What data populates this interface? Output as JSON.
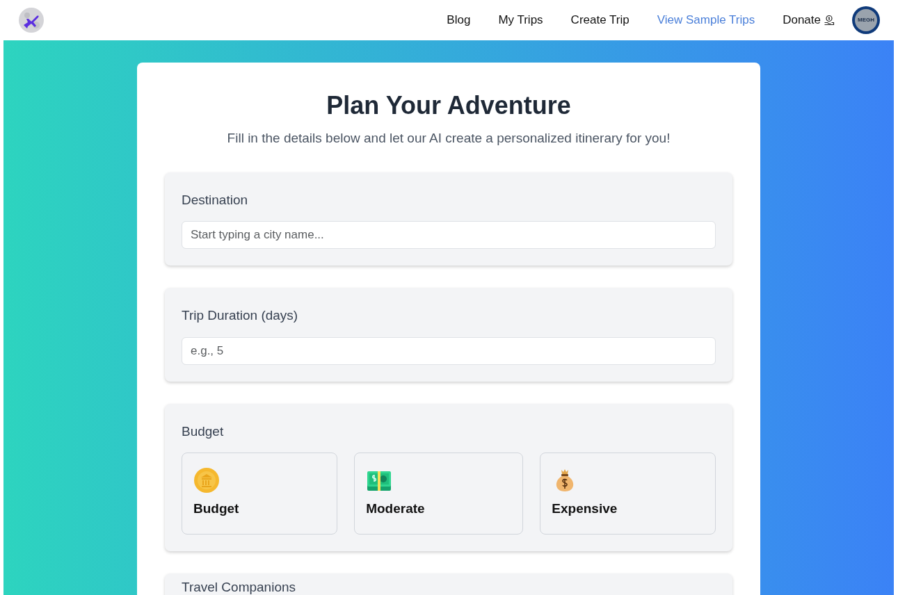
{
  "nav": {
    "links": [
      {
        "label": "Blog",
        "selected": false
      },
      {
        "label": "My Trips",
        "selected": false
      },
      {
        "label": "Create Trip",
        "selected": false
      },
      {
        "label": "View Sample Trips",
        "selected": true
      },
      {
        "label": "Donate",
        "selected": false,
        "kind": "with_icon"
      }
    ],
    "avatar": "MEGH"
  },
  "form": {
    "title": "Plan Your Adventure",
    "subtitle": "Fill in the details below and let our AI create a personalized itinerary for you!",
    "sections": [
      {
        "kind": "input",
        "label": "Destination",
        "placeholder": "Start typing a city name..."
      },
      {
        "kind": "input",
        "label": "Trip Duration (days)",
        "placeholder": "e.g., 5"
      },
      {
        "kind": "options",
        "label": "Budget",
        "options": [
          {
            "label": "Budget",
            "selected": false
          },
          {
            "label": "Moderate",
            "selected": false
          },
          {
            "label": "Expensive",
            "selected": false
          }
        ]
      },
      {
        "kind": "heading",
        "label": "Travel Companions"
      }
    ]
  }
}
